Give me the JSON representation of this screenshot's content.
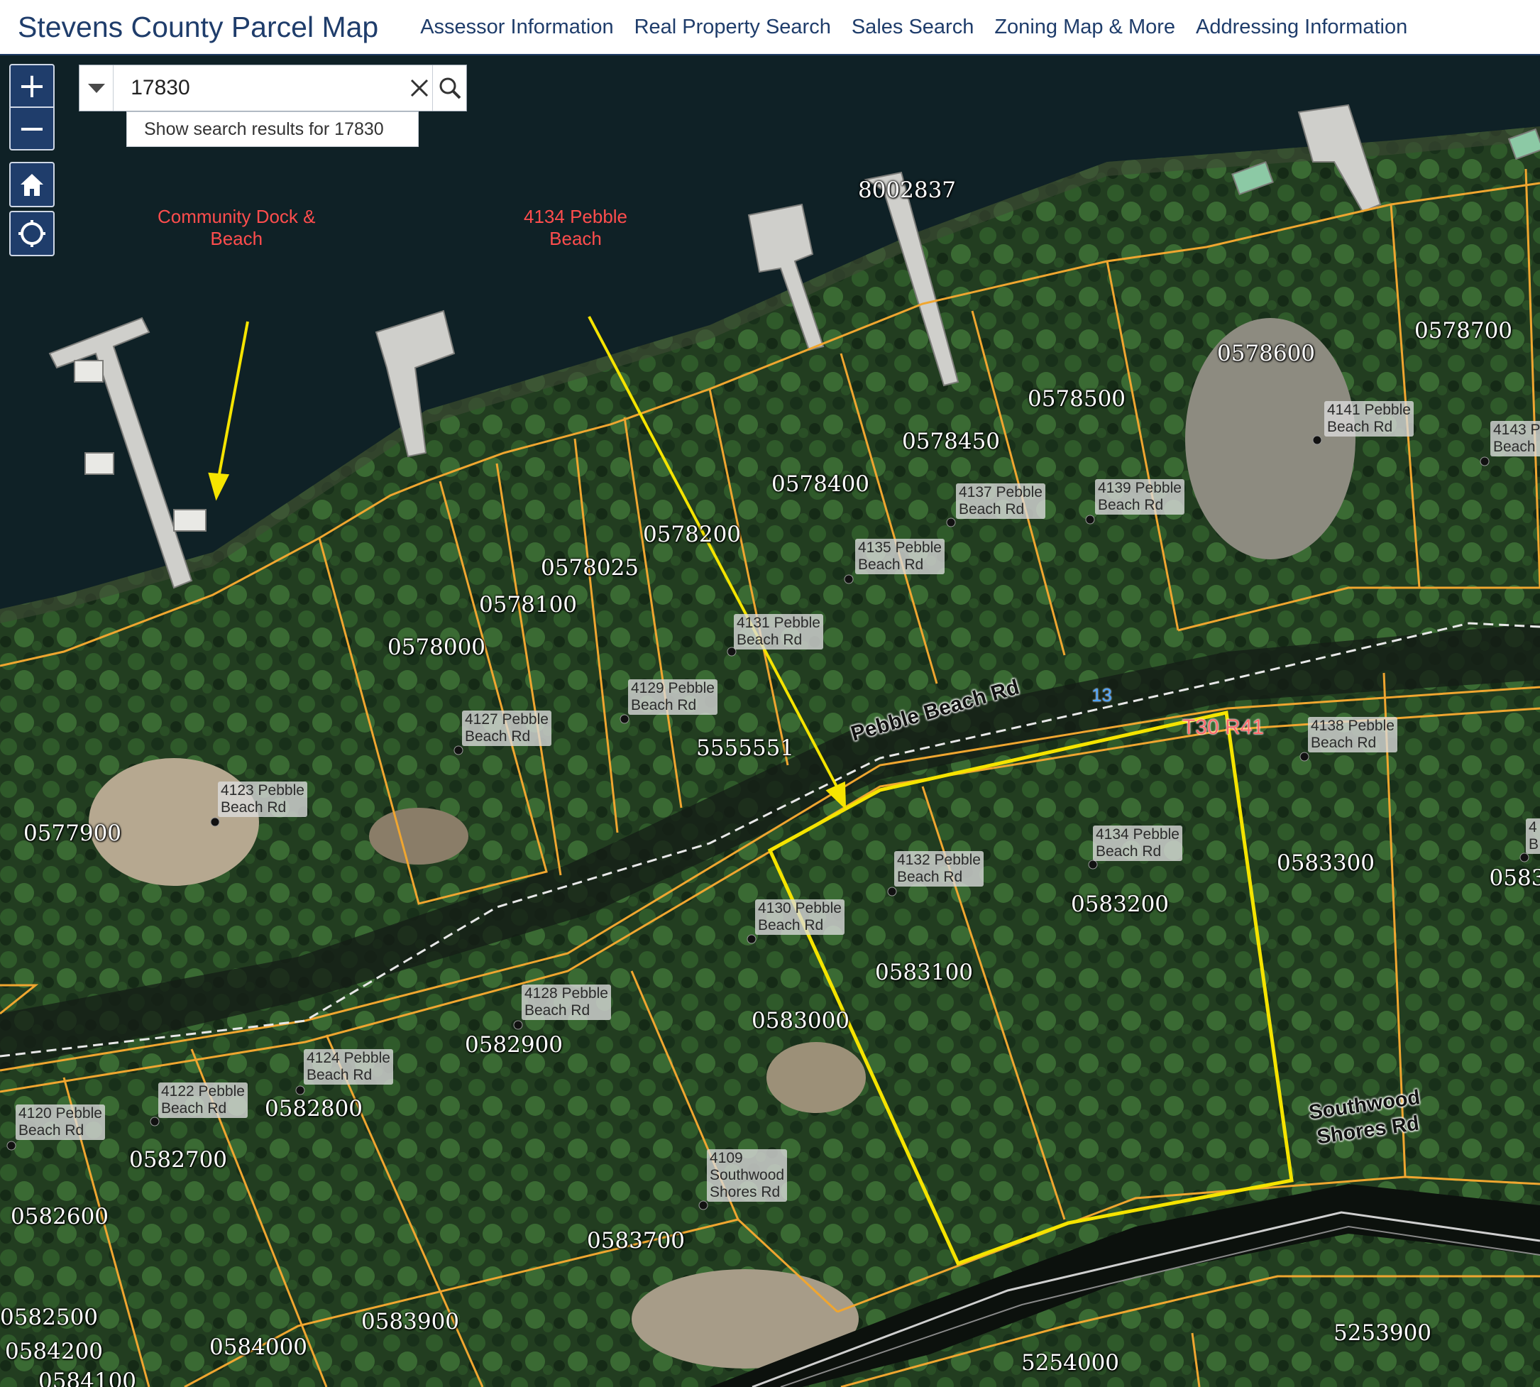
{
  "header": {
    "title": "Stevens County Parcel Map",
    "nav": [
      "Assessor Information",
      "Real Property Search",
      "Sales Search",
      "Zoning Map & More",
      "Addressing Information"
    ]
  },
  "search": {
    "value": "17830",
    "suggestion": "Show search results for 17830"
  },
  "controls": {
    "zoom_in": "+",
    "zoom_out": "−",
    "home_icon": "home-icon",
    "locate_icon": "locate-icon"
  },
  "annotations": [
    "Community Dock &\nBeach",
    "4134 Pebble\nBeach"
  ],
  "parcel_numbers": [
    "8002837",
    "0578700",
    "0578600",
    "0578500",
    "0578450",
    "0578400",
    "0578200",
    "0578025",
    "0578100",
    "0578000",
    "5555551",
    "0577900",
    "0583300",
    "0583200",
    "0583100",
    "0583000",
    "0582900",
    "0582800",
    "0582700",
    "0582600",
    "0582500",
    "0584200",
    "0584100",
    "0584000",
    "0583900",
    "0583700",
    "5254000",
    "5253900",
    "0583"
  ],
  "addresses": [
    "4141 Pebble\nBeach Rd",
    "4143 P\nBeach",
    "4137 Pebble\nBeach Rd",
    "4139 Pebble\nBeach Rd",
    "4135 Pebble\nBeach Rd",
    "4131 Pebble\nBeach Rd",
    "4129 Pebble\nBeach Rd",
    "4127 Pebble\nBeach Rd",
    "4123 Pebble\nBeach Rd",
    "4138 Pebble\nBeach Rd",
    "4134 Pebble\nBeach Rd",
    "4132 Pebble\nBeach Rd",
    "4130 Pebble\nBeach Rd",
    "4128 Pebble\nBeach Rd",
    "4124 Pebble\nBeach Rd",
    "4122 Pebble\nBeach Rd",
    "4120 Pebble\nBeach Rd",
    "4109\nSouthwood\nShores Rd",
    "4\nB"
  ],
  "roads": [
    "Pebble Beach Rd",
    "Southwood\nShores Rd"
  ],
  "township": "T30 R41",
  "section": "13",
  "scale": "60ft",
  "colors": {
    "header_text": "#1f3d6b",
    "parcel_line": "#f0a630",
    "highlight": "#f5e400",
    "annotation": "#ff4d4d",
    "water": "#0f2126",
    "forest": "#1f3a1c"
  }
}
